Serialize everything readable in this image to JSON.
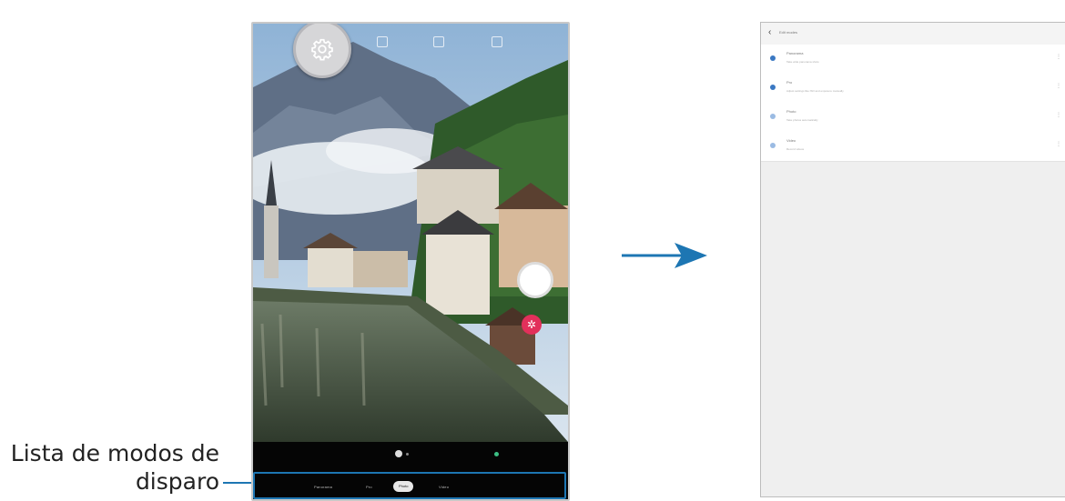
{
  "callout": {
    "label_line1": "Lista de modos de",
    "label_line2": "disparo"
  },
  "camera": {
    "settings_icon": "gear-icon",
    "modes": [
      "Panorama",
      "Pro",
      "Photo",
      "Video"
    ],
    "selected_mode_index": 2,
    "colors": {
      "accent": "#1d76b3",
      "effect_button": "#e2305b"
    }
  },
  "settings_screen": {
    "back_icon": "chevron-left-icon",
    "title": "Edit modes",
    "items": [
      {
        "title": "Panorama",
        "description": "Take wide panorama shots",
        "enabled": true
      },
      {
        "title": "Pro",
        "description": "Adjust settings like ISO and exposure manually",
        "enabled": true
      },
      {
        "title": "Photo",
        "description": "Take photos automatically",
        "enabled": false
      },
      {
        "title": "Video",
        "description": "Record videos",
        "enabled": false
      }
    ]
  },
  "transition_icon": "right-arrow-icon"
}
